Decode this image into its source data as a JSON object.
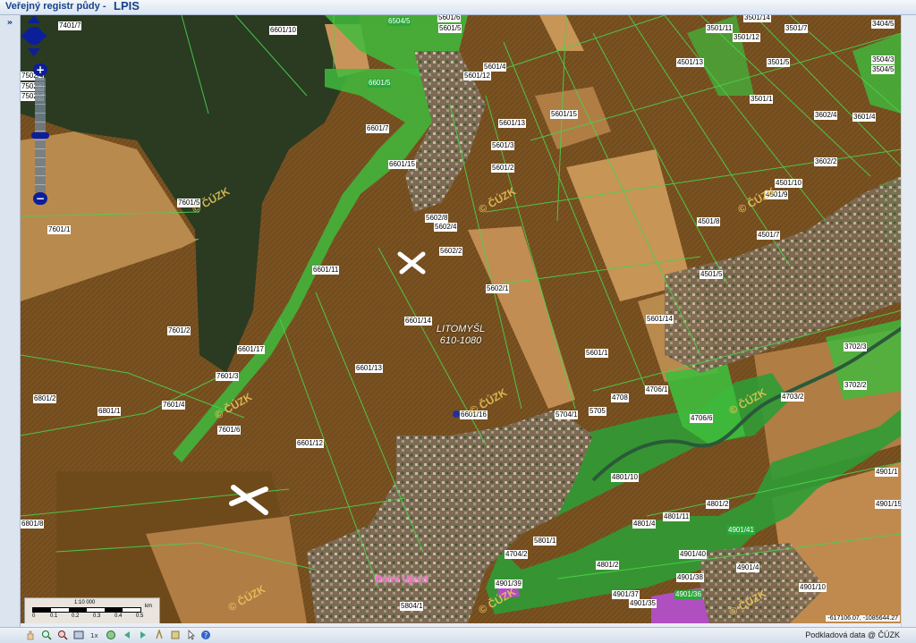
{
  "window": {
    "title_prefix": "Veřejný registr půdy - ",
    "title_app": "LPIS"
  },
  "sidebar": {
    "expand_icon": "»"
  },
  "map": {
    "parcels": [
      {
        "id": "7401/7"
      },
      {
        "id": "6601/10"
      },
      {
        "id": "6504/5"
      },
      {
        "id": "5601/6"
      },
      {
        "id": "5601/5"
      },
      {
        "id": "3501/14"
      },
      {
        "id": "3501/11"
      },
      {
        "id": "3501/12"
      },
      {
        "id": "3501/7"
      },
      {
        "id": "3404/5"
      },
      {
        "id": "5601/4"
      },
      {
        "id": "5601/12"
      },
      {
        "id": "4501/13"
      },
      {
        "id": "3501/5"
      },
      {
        "id": "3504/3"
      },
      {
        "id": "3504/5"
      },
      {
        "id": "6601/5"
      },
      {
        "id": "3501/1"
      },
      {
        "id": "7502/4"
      },
      {
        "id": "7502/3"
      },
      {
        "id": "7502/5"
      },
      {
        "id": "6601/7"
      },
      {
        "id": "5601/15"
      },
      {
        "id": "5601/13"
      },
      {
        "id": "3602/4"
      },
      {
        "id": "3601/4"
      },
      {
        "id": "5601/3"
      },
      {
        "id": "6601/15"
      },
      {
        "id": "5601/2"
      },
      {
        "id": "3602/2"
      },
      {
        "id": "4501/10"
      },
      {
        "id": "4501/9"
      },
      {
        "id": "7601/5"
      },
      {
        "id": "5602/8"
      },
      {
        "id": "5602/4"
      },
      {
        "id": "4501/8"
      },
      {
        "id": "4501/7"
      },
      {
        "id": "7601/1"
      },
      {
        "id": "5602/2"
      },
      {
        "id": "6601/11"
      },
      {
        "id": "4501/5"
      },
      {
        "id": "5602/1"
      },
      {
        "id": "6601/14"
      },
      {
        "id": "5601/14"
      },
      {
        "id": "7601/2"
      },
      {
        "id": "6601/17"
      },
      {
        "id": "5601/1"
      },
      {
        "id": "3702/3"
      },
      {
        "id": "6601/13"
      },
      {
        "id": "7601/3"
      },
      {
        "id": "3702/2"
      },
      {
        "id": "4706/1"
      },
      {
        "id": "4708"
      },
      {
        "id": "4703/2"
      },
      {
        "id": "6801/2"
      },
      {
        "id": "7601/4"
      },
      {
        "id": "6801/1"
      },
      {
        "id": "5705"
      },
      {
        "id": "5704/1"
      },
      {
        "id": "6601/16"
      },
      {
        "id": "4706/6"
      },
      {
        "id": "7601/6"
      },
      {
        "id": "6601/12"
      },
      {
        "id": "4901/1"
      },
      {
        "id": "4801/10"
      },
      {
        "id": "4901/15"
      },
      {
        "id": "4801/2"
      },
      {
        "id": "4801/11"
      },
      {
        "id": "4801/4"
      },
      {
        "id": "4901/41"
      },
      {
        "id": "6801/8"
      },
      {
        "id": "5801/1"
      },
      {
        "id": "4901/40"
      },
      {
        "id": "4704/2"
      },
      {
        "id": "4801/2"
      },
      {
        "id": "4901/4"
      },
      {
        "id": "4901/38"
      },
      {
        "id": "4901/39"
      },
      {
        "id": "4901/10"
      },
      {
        "id": "4901/36"
      },
      {
        "id": "4901/37"
      },
      {
        "id": "4901/35"
      },
      {
        "id": "5804/1"
      }
    ],
    "watermark": "© ČÚZK",
    "town_name": "LITOMYŠL",
    "town_code": "610-1080",
    "district_label": "Dolní Újezd",
    "green_labels": [
      "6504/5",
      "6601/5",
      "4703/2",
      "4801/10",
      "4901/41",
      "4901/36"
    ]
  },
  "scale": {
    "ratio": "1:10 000",
    "ticks": [
      "0",
      "0.1",
      "0.2",
      "0.3",
      "0.4",
      "0.5"
    ],
    "unit": "km"
  },
  "coordinates": "-617106.07, -1085644.27",
  "footer": {
    "credit": "Podkladová data @ ČÚZK"
  },
  "toolbar": {
    "icons": [
      "hand-icon",
      "zoom-in-icon",
      "zoom-out-icon",
      "full-extent-icon",
      "measure-icon",
      "refresh-icon",
      "back-icon",
      "forward-icon",
      "print-icon",
      "layers-icon",
      "select-icon",
      "help-icon"
    ]
  }
}
